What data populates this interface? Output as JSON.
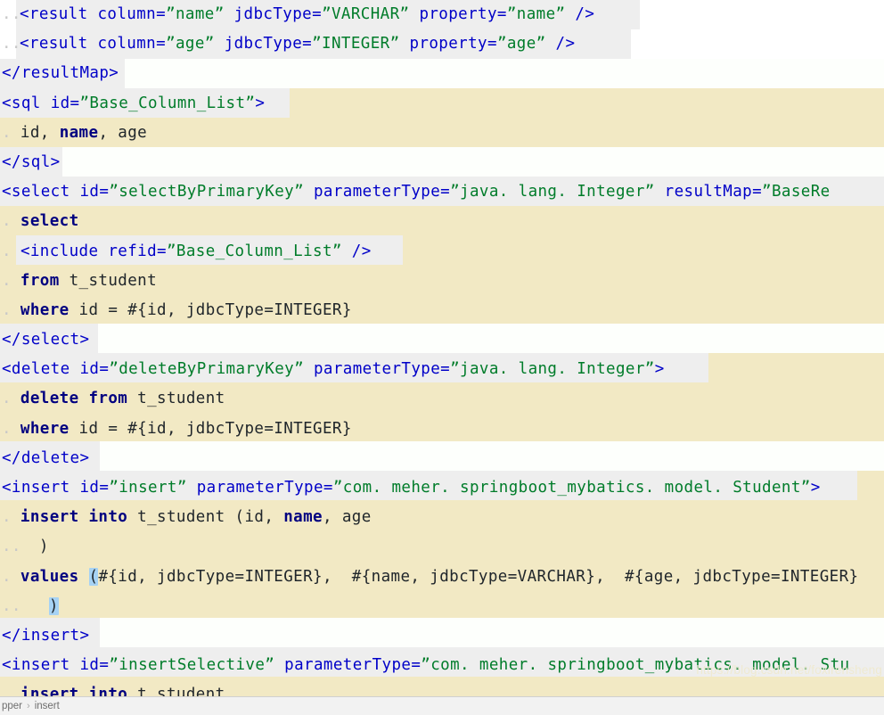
{
  "editor": {
    "language": "xml",
    "file_kind": "mybatis-mapper",
    "colors": {
      "tag": "#0000c8",
      "attribute_value": "#007c2a",
      "sql_keyword": "#000080",
      "folded_region_background": "#f2e9c4",
      "tag_line_background": "#eeeeee",
      "bracket_match_background": "#a6d2f4",
      "editor_background": "#ffffff",
      "statusbar_background": "#f2f2f2"
    },
    "lines": [
      {
        "id": "line-result-name",
        "indent_dots": "..",
        "segments": [
          {
            "kind": "tag",
            "text": "<result "
          },
          {
            "kind": "attr",
            "text": "column="
          },
          {
            "kind": "attrval",
            "text": "”name”"
          },
          {
            "kind": "plain",
            "text": " "
          },
          {
            "kind": "attr",
            "text": "jdbcType="
          },
          {
            "kind": "attrval",
            "text": "”VARCHAR”"
          },
          {
            "kind": "plain",
            "text": " "
          },
          {
            "kind": "attr",
            "text": "property="
          },
          {
            "kind": "attrval",
            "text": "”name”"
          },
          {
            "kind": "tag",
            "text": " />"
          }
        ]
      },
      {
        "id": "line-result-age",
        "indent_dots": "..",
        "segments": [
          {
            "kind": "tag",
            "text": "<result "
          },
          {
            "kind": "attr",
            "text": "column="
          },
          {
            "kind": "attrval",
            "text": "”age”"
          },
          {
            "kind": "plain",
            "text": " "
          },
          {
            "kind": "attr",
            "text": "jdbcType="
          },
          {
            "kind": "attrval",
            "text": "”INTEGER”"
          },
          {
            "kind": "plain",
            "text": " "
          },
          {
            "kind": "attr",
            "text": "property="
          },
          {
            "kind": "attrval",
            "text": "”age”"
          },
          {
            "kind": "tag",
            "text": " />"
          }
        ]
      },
      {
        "id": "line-close-resultmap",
        "indent_dots": "",
        "segments": [
          {
            "kind": "tag",
            "text": "</resultMap>"
          }
        ]
      },
      {
        "id": "line-sql-open",
        "indent_dots": "",
        "segments": [
          {
            "kind": "tag",
            "text": "<sql "
          },
          {
            "kind": "attr",
            "text": "id="
          },
          {
            "kind": "attrval",
            "text": "”Base_Column_List”"
          },
          {
            "kind": "tag",
            "text": ">"
          }
        ]
      },
      {
        "id": "line-columns",
        "indent_dots": ".",
        "segments": [
          {
            "kind": "plain",
            "text": " id, "
          },
          {
            "kind": "kw",
            "text": "name"
          },
          {
            "kind": "plain",
            "text": ", age"
          }
        ]
      },
      {
        "id": "line-sql-close",
        "indent_dots": "",
        "segments": [
          {
            "kind": "tag",
            "text": "</sql>"
          }
        ]
      },
      {
        "id": "line-select-open",
        "indent_dots": "",
        "segments": [
          {
            "kind": "tag",
            "text": "<select "
          },
          {
            "kind": "attr",
            "text": "id="
          },
          {
            "kind": "attrval",
            "text": "”selectByPrimaryKey”"
          },
          {
            "kind": "plain",
            "text": " "
          },
          {
            "kind": "attr",
            "text": "parameterType="
          },
          {
            "kind": "attrval",
            "text": "”java. lang. Integer”"
          },
          {
            "kind": "plain",
            "text": " "
          },
          {
            "kind": "attr",
            "text": "resultMap="
          },
          {
            "kind": "attrval",
            "text": "”BaseRe"
          }
        ]
      },
      {
        "id": "line-select-kw",
        "indent_dots": ".",
        "segments": [
          {
            "kind": "kw",
            "text": " select"
          }
        ]
      },
      {
        "id": "line-include",
        "indent_dots": ".",
        "segments": [
          {
            "kind": "plain",
            "text": " "
          },
          {
            "kind": "tag",
            "text": "<include "
          },
          {
            "kind": "attr",
            "text": "refid="
          },
          {
            "kind": "attrval",
            "text": "”Base_Column_List”"
          },
          {
            "kind": "tag",
            "text": " />"
          }
        ]
      },
      {
        "id": "line-from-student",
        "indent_dots": ".",
        "segments": [
          {
            "kind": "kw",
            "text": " from"
          },
          {
            "kind": "plain",
            "text": " t_student"
          }
        ]
      },
      {
        "id": "line-where-id",
        "indent_dots": ".",
        "segments": [
          {
            "kind": "kw",
            "text": " where"
          },
          {
            "kind": "plain",
            "text": " id = #{id, jdbcType=INTEGER}"
          }
        ]
      },
      {
        "id": "line-select-close",
        "indent_dots": "",
        "segments": [
          {
            "kind": "tag",
            "text": "</select>"
          }
        ]
      },
      {
        "id": "line-delete-open",
        "indent_dots": "",
        "segments": [
          {
            "kind": "tag",
            "text": "<delete "
          },
          {
            "kind": "attr",
            "text": "id="
          },
          {
            "kind": "attrval",
            "text": "”deleteByPrimaryKey”"
          },
          {
            "kind": "plain",
            "text": " "
          },
          {
            "kind": "attr",
            "text": "parameterType="
          },
          {
            "kind": "attrval",
            "text": "”java. lang. Integer”"
          },
          {
            "kind": "tag",
            "text": ">"
          }
        ]
      },
      {
        "id": "line-delete-from",
        "indent_dots": ".",
        "segments": [
          {
            "kind": "kw",
            "text": " delete from"
          },
          {
            "kind": "plain",
            "text": " t_student"
          }
        ]
      },
      {
        "id": "line-delete-where",
        "indent_dots": ".",
        "segments": [
          {
            "kind": "kw",
            "text": " where"
          },
          {
            "kind": "plain",
            "text": " id = #{id, jdbcType=INTEGER}"
          }
        ]
      },
      {
        "id": "line-delete-close",
        "indent_dots": "",
        "segments": [
          {
            "kind": "tag",
            "text": "</delete>"
          }
        ]
      },
      {
        "id": "line-insert-open",
        "indent_dots": "",
        "segments": [
          {
            "kind": "tag",
            "text": "<insert "
          },
          {
            "kind": "attr",
            "text": "id="
          },
          {
            "kind": "attrval",
            "text": "”insert”"
          },
          {
            "kind": "plain",
            "text": " "
          },
          {
            "kind": "attr",
            "text": "parameterType="
          },
          {
            "kind": "attrval",
            "text": "”com. meher. springboot_mybatics. model. Student”"
          },
          {
            "kind": "tag",
            "text": ">"
          }
        ]
      },
      {
        "id": "line-insert-into",
        "indent_dots": ".",
        "segments": [
          {
            "kind": "kw",
            "text": " insert into"
          },
          {
            "kind": "plain",
            "text": " t_student (id, "
          },
          {
            "kind": "kw",
            "text": "name"
          },
          {
            "kind": "plain",
            "text": ", age"
          }
        ]
      },
      {
        "id": "line-close-paren-1",
        "indent_dots": "..",
        "segments": [
          {
            "kind": "plain",
            "text": "  )"
          }
        ]
      },
      {
        "id": "line-values",
        "indent_dots": ".",
        "segments": [
          {
            "kind": "kw",
            "text": " values"
          },
          {
            "kind": "plain",
            "text": " "
          },
          {
            "kind": "match",
            "text": "("
          },
          {
            "kind": "plain",
            "text": "#{id, jdbcType=INTEGER},  #{name, jdbcType=VARCHAR},  #{age, jdbcType=INTEGER}"
          }
        ]
      },
      {
        "id": "line-close-paren-2",
        "indent_dots": "..",
        "segments": [
          {
            "kind": "plain",
            "text": "   "
          },
          {
            "kind": "match",
            "text": ")"
          }
        ]
      },
      {
        "id": "line-insert-close",
        "indent_dots": "",
        "segments": [
          {
            "kind": "tag",
            "text": "</insert>"
          }
        ]
      },
      {
        "id": "line-insertselective-open",
        "indent_dots": "",
        "segments": [
          {
            "kind": "tag",
            "text": "<insert "
          },
          {
            "kind": "attr",
            "text": "id="
          },
          {
            "kind": "attrval",
            "text": "”insertSelective”"
          },
          {
            "kind": "plain",
            "text": " "
          },
          {
            "kind": "attr",
            "text": "parameterType="
          },
          {
            "kind": "attrval",
            "text": "”com. meher. springboot_mybatics. model. Stu"
          }
        ]
      },
      {
        "id": "line-insertselective-into",
        "indent_dots": ".",
        "segments": [
          {
            "kind": "kw",
            "text": " insert into"
          },
          {
            "kind": "plain",
            "text": " t student"
          }
        ]
      }
    ]
  },
  "statusbar": {
    "breadcrumb": [
      {
        "label": "pper"
      },
      {
        "label": "insert"
      }
    ],
    "separator": "›"
  },
  "watermark": {
    "text": "https://blog.csdn.net/foxirensheng"
  }
}
